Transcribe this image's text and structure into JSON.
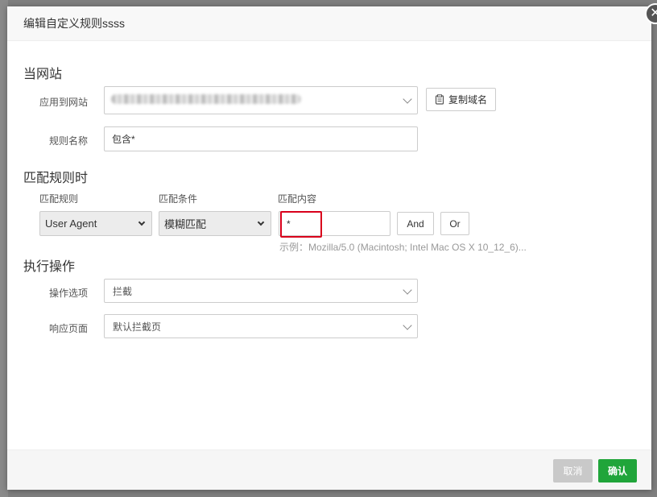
{
  "dialog": {
    "title": "编辑自定义规则ssss",
    "close_icon": "close-icon"
  },
  "site_section": {
    "title": "当网站",
    "apply_label": "应用到网站",
    "apply_value": "",
    "copy_domain_label": "复制域名",
    "copy_icon": "clipboard-icon",
    "rule_name_label": "规则名称",
    "rule_name_value": "包含*"
  },
  "match_section": {
    "title": "匹配规则时",
    "col_rule": "匹配规则",
    "col_condition": "匹配条件",
    "col_content": "匹配内容",
    "rule_value": "User Agent",
    "condition_value": "模糊匹配",
    "content_value": "*",
    "and_label": "And",
    "or_label": "Or",
    "hint": "示例：Mozilla/5.0 (Macintosh; Intel Mac OS X 10_12_6)..."
  },
  "action_section": {
    "title": "执行操作",
    "option_label": "操作选项",
    "option_value": "拦截",
    "page_label": "响应页面",
    "page_value": "默认拦截页"
  },
  "footer": {
    "cancel_label": "取消",
    "ok_label": "确认"
  },
  "colors": {
    "primary": "#20a53a",
    "highlight": "#d9001b",
    "disabled": "#c9c9c9"
  }
}
